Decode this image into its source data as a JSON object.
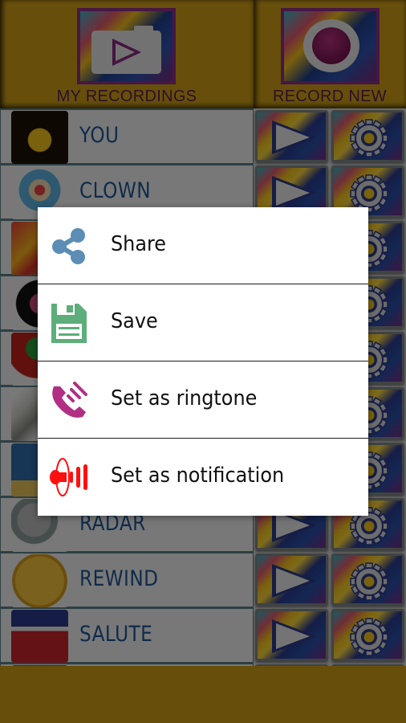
{
  "header": {
    "my_recordings_label": "MY RECORDINGS",
    "record_new_label": "RECORD NEW",
    "my_recordings_icon": "folder-play-icon",
    "record_new_icon": "record-icon"
  },
  "list": {
    "rows": [
      {
        "label": "YOU",
        "thumb": "pumpkin"
      },
      {
        "label": "CLOWN",
        "thumb": "clown"
      },
      {
        "label": "",
        "thumb": "flower-pattern"
      },
      {
        "label": "",
        "thumb": "porthole"
      },
      {
        "label": "",
        "thumb": "worm-heart"
      },
      {
        "label": "",
        "thumb": "rope"
      },
      {
        "label": "",
        "thumb": "seahorse"
      },
      {
        "label": "RADAR",
        "thumb": "satellite-dish"
      },
      {
        "label": "REWIND",
        "thumb": "fast-forward"
      },
      {
        "label": "SALUTE",
        "thumb": "soldier-flag"
      },
      {
        "label": "",
        "thumb": "partial"
      }
    ],
    "row_actions": {
      "play_icon": "play-icon",
      "settings_icon": "gear-icon"
    }
  },
  "dialog": {
    "items": [
      {
        "label": "Share",
        "icon": "share-icon",
        "color": "#5b8db5"
      },
      {
        "label": "Save",
        "icon": "floppy-disk-icon",
        "color": "#5dae7a"
      },
      {
        "label": "Set as ringtone",
        "icon": "phone-ringing-icon",
        "color": "#b02f83"
      },
      {
        "label": "Set as notification",
        "icon": "speaker-icon",
        "color": "#ff1010"
      }
    ]
  },
  "colors": {
    "header_gold": "#cf9f17",
    "row_label_blue": "#1d5797",
    "header_label_purple": "#5a1f55"
  }
}
